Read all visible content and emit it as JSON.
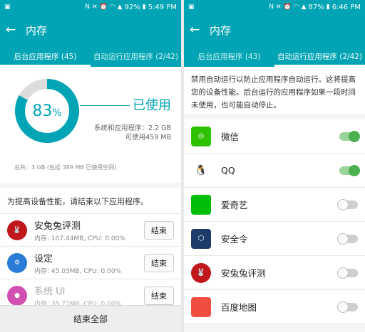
{
  "left": {
    "status": {
      "battery": "92%",
      "time": "5:49 PM"
    },
    "title": "内存",
    "tabs": [
      "后台应用程序 (45)",
      "自动运行应用程序 (2/42)"
    ],
    "memory": {
      "percent_value": "83",
      "percent_sign": "%",
      "used_label": "已使用",
      "system_apps": "系统和应用程序：2.2 GB",
      "available": "可使用459 MB",
      "total": "总共：3 GB (包括 389 MB 已使用空间)"
    },
    "hint": "为提高设备性能，请结束以下应用程序。",
    "apps": [
      {
        "name": "安兔兔评测",
        "stats": "内存: 107.44MB, CPU: 0.00%",
        "button": "结束",
        "icon": "antutu-icon"
      },
      {
        "name": "设定",
        "stats": "内存: 45.03MB, CPU: 0.00%",
        "button": "结束",
        "icon": "settings-icon"
      },
      {
        "name": "系统 UI",
        "stats": "内存: 35.77MB, CPU: 0.00%",
        "button": "结束",
        "icon": "lollipop-icon"
      }
    ],
    "end_all": "结束全部"
  },
  "right": {
    "status": {
      "battery": "87%",
      "time": "6:46 PM"
    },
    "title": "内存",
    "tabs": [
      "后台应用程序 (43)",
      "自动运行应用程序 (2/42)"
    ],
    "description": "禁用自动运行以防止应用程序自动运行。这将提高您的设备性能。后台运行的应用程序如果一段时间未使用，也可能自动停止。",
    "apps": [
      {
        "name": "微信",
        "enabled": true,
        "icon": "wechat-icon"
      },
      {
        "name": "QQ",
        "enabled": true,
        "icon": "qq-icon"
      },
      {
        "name": "爱奇艺",
        "enabled": false,
        "icon": "iqiyi-icon"
      },
      {
        "name": "安全令",
        "enabled": false,
        "icon": "security-token-icon"
      },
      {
        "name": "安兔兔评测",
        "enabled": false,
        "icon": "antutu-icon"
      },
      {
        "name": "百度地图",
        "enabled": false,
        "icon": "baidu-map-icon"
      }
    ]
  },
  "colors": {
    "accent": "#00a4b4",
    "switch_on": "#4caf50"
  }
}
